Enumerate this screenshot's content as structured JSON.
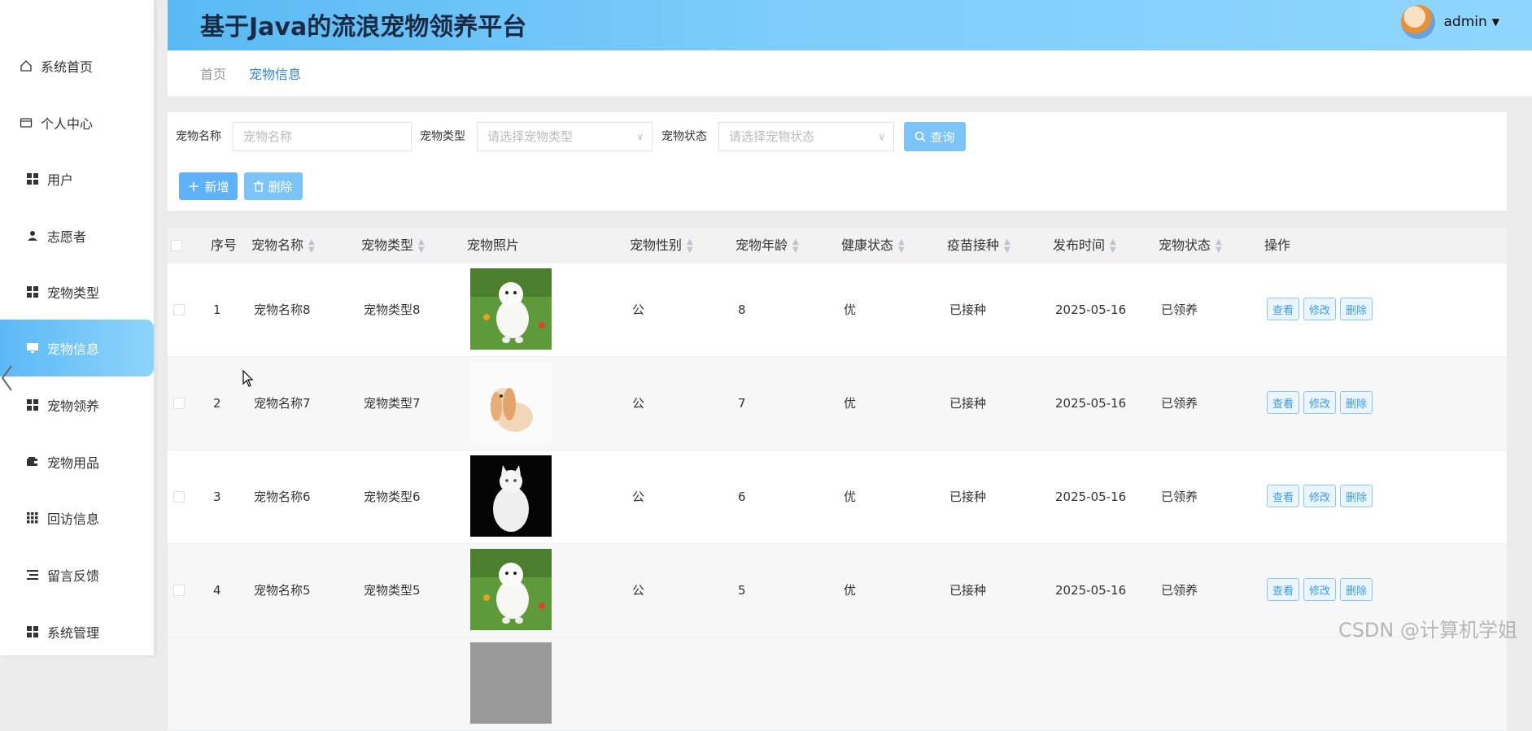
{
  "header": {
    "title": "基于Java的流浪宠物领养平台",
    "user": "admin"
  },
  "sidebar": {
    "items": [
      {
        "label": "系统首页"
      },
      {
        "label": "个人中心"
      },
      {
        "label": "用户"
      },
      {
        "label": "志愿者"
      },
      {
        "label": "宠物类型"
      },
      {
        "label": "宠物信息"
      },
      {
        "label": "宠物领养"
      },
      {
        "label": "宠物用品"
      },
      {
        "label": "回访信息"
      },
      {
        "label": "留言反馈"
      },
      {
        "label": "系统管理"
      }
    ],
    "active": "宠物信息"
  },
  "breadcrumb": {
    "home": "首页",
    "current": "宠物信息"
  },
  "search": {
    "name_label": "宠物名称",
    "name_placeholder": "宠物名称",
    "type_label": "宠物类型",
    "type_placeholder": "请选择宠物类型",
    "status_label": "宠物状态",
    "status_placeholder": "请选择宠物状态",
    "query_label": "查询"
  },
  "toolbar": {
    "add_label": "新增",
    "delete_label": "删除"
  },
  "table": {
    "columns": [
      "序号",
      "宠物名称",
      "宠物类型",
      "宠物照片",
      "宠物性别",
      "宠物年龄",
      "健康状态",
      "疫苗接种",
      "发布时间",
      "宠物状态",
      "操作"
    ],
    "rows": [
      {
        "index": "1",
        "name": "宠物名称8",
        "type": "宠物类型8",
        "photo": "white-dog",
        "gender": "公",
        "age": "8",
        "health": "优",
        "vaccine": "已接种",
        "date": "2025-05-16",
        "status": "已领养"
      },
      {
        "index": "2",
        "name": "宠物名称7",
        "type": "宠物类型7",
        "photo": "rabbit",
        "gender": "公",
        "age": "7",
        "health": "优",
        "vaccine": "已接种",
        "date": "2025-05-16",
        "status": "已领养"
      },
      {
        "index": "3",
        "name": "宠物名称6",
        "type": "宠物类型6",
        "photo": "white-cat",
        "gender": "公",
        "age": "6",
        "health": "优",
        "vaccine": "已接种",
        "date": "2025-05-16",
        "status": "已领养"
      },
      {
        "index": "4",
        "name": "宠物名称5",
        "type": "宠物类型5",
        "photo": "white-dog",
        "gender": "公",
        "age": "5",
        "health": "优",
        "vaccine": "已接种",
        "date": "2025-05-16",
        "status": "已领养"
      }
    ],
    "actions": {
      "view": "查看",
      "edit": "修改",
      "delete": "删除"
    }
  },
  "watermark": "CSDN @计算机学姐",
  "colors": {
    "accent": "#5fb2f7",
    "header_start": "#5ab9f3",
    "header_end": "#8fd6fc",
    "active_link": "#2f86d6"
  }
}
